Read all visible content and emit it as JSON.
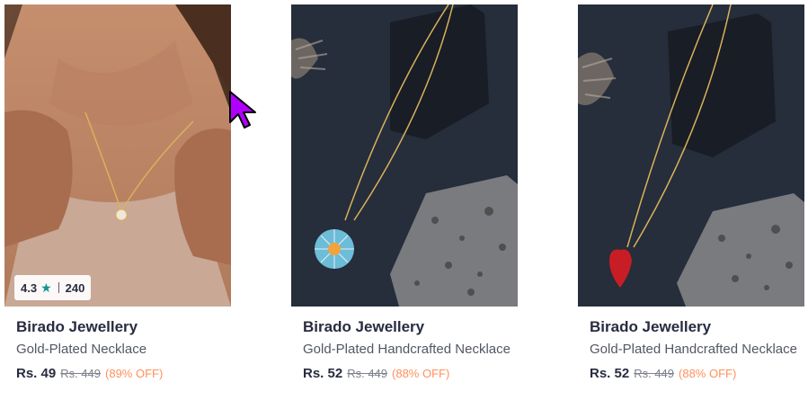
{
  "products": [
    {
      "brand": "Birado Jewellery",
      "title": "Gold-Plated Necklace",
      "price": "Rs. 49",
      "mrp": "Rs. 449",
      "discount": "(89% OFF)",
      "rating": "4.3",
      "rating_count": "240",
      "image_icon": "model-wearing-necklace"
    },
    {
      "brand": "Birado Jewellery",
      "title": "Gold-Plated Handcrafted Necklace",
      "price": "Rs. 52",
      "mrp": "Rs. 449",
      "discount": "(88% OFF)",
      "image_icon": "flower-pendant-necklace"
    },
    {
      "brand": "Birado Jewellery",
      "title": "Gold-Plated Handcrafted Necklace",
      "price": "Rs. 52",
      "mrp": "Rs. 449",
      "discount": "(88% OFF)",
      "image_icon": "heart-pendant-necklace"
    }
  ],
  "colors": {
    "brand_text": "#282c3f",
    "discount": "#ff905a",
    "rating_star": "#14958f",
    "cursor": "#b000ff"
  }
}
